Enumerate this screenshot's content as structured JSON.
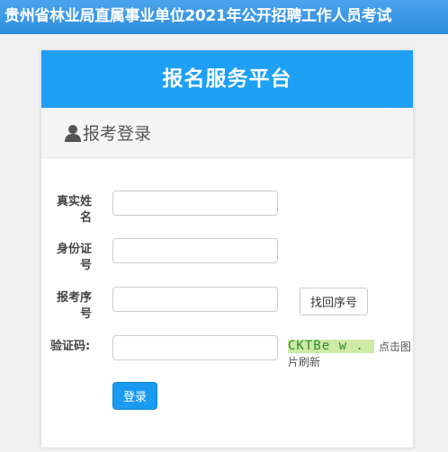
{
  "banner": {
    "title": "贵州省林业局直属事业单位2021年公开招聘工作人员考试"
  },
  "card": {
    "title": "报名服务平台",
    "subtitle": "报考登录"
  },
  "form": {
    "name_label": "真实姓名",
    "id_label": "身份证号",
    "seq_label": "报考序号",
    "captcha_label": "验证码:",
    "find_seq_button": "找回序号",
    "captcha_text": "CKTBe w .",
    "refresh_hint_1": "点击图",
    "refresh_hint_2": "片刷新",
    "login_button": "登录"
  },
  "colors": {
    "banner": "#3a98e6",
    "header": "#1ea0f4",
    "login_button": "#1a9af0"
  }
}
